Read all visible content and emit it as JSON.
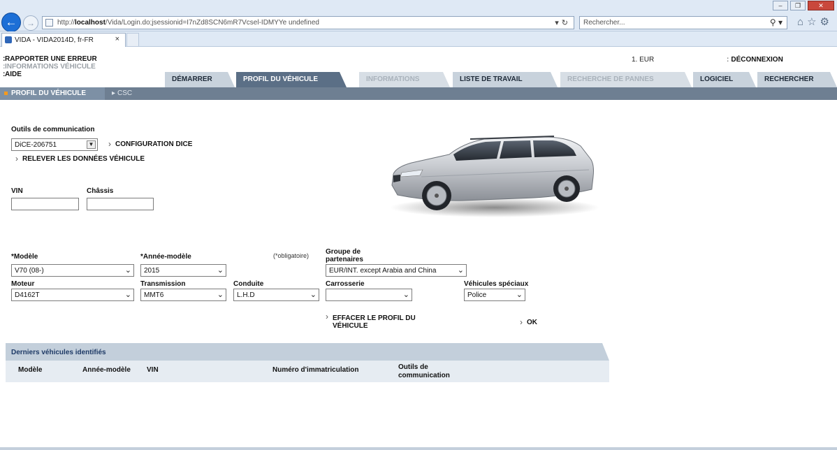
{
  "browser": {
    "url_prefix": "http://",
    "url_host": "localhost",
    "url_rest": "/Vida/Login.do;jsessionid=I7nZd8SCN6mR7Vcsel-IDMYYe undefined",
    "search_placeholder": "Rechercher...",
    "tab_title": "VIDA - VIDA2014D, fr-FR",
    "tab_close": "×"
  },
  "header": {
    "links": [
      "RAPPORTER UNE ERREUR",
      "INFORMATIONS VÉHICULE",
      "AIDE"
    ],
    "currency": "1. EUR",
    "logout": "DÉCONNEXION"
  },
  "tabs": [
    {
      "label": "DÉMARRER",
      "state": "normal"
    },
    {
      "label": "PROFIL DU VÉHICULE",
      "state": "active"
    },
    {
      "label": "INFORMATIONS",
      "state": "disabled"
    },
    {
      "label": "LISTE DE TRAVAIL",
      "state": "normal"
    },
    {
      "label": "RECHERCHE DE PANNES",
      "state": "disabled"
    },
    {
      "label": "LOGICIEL",
      "state": "normal"
    },
    {
      "label": "RECHERCHER",
      "state": "normal"
    }
  ],
  "breadcrumb": {
    "active": "PROFIL DU VÉHICULE",
    "next": "CSC"
  },
  "comm": {
    "label": "Outils de communication",
    "device": "DiCE-206751",
    "config_link": "CONFIGURATION DICE",
    "read_link": "RELEVER LES DONNÉES VÉHICULE"
  },
  "ident": {
    "vin_label": "VIN",
    "chassis_label": "Châssis",
    "vin_value": "",
    "chassis_value": ""
  },
  "form": {
    "required_note": "(*obligatoire)",
    "model_label": "*Modèle",
    "model_value": "V70 (08-)",
    "year_label": "*Année-modèle",
    "year_value": "2015",
    "partner_label_1": "Groupe de",
    "partner_label_2": "partenaires",
    "partner_value": "EUR/INT. except Arabia and China",
    "engine_label": "Moteur",
    "engine_value": "D4162T",
    "transmission_label": "Transmission",
    "transmission_value": "MMT6",
    "drive_label": "Conduite",
    "drive_value": "L.H.D",
    "body_label": "Carrosserie",
    "body_value": "",
    "special_label": "Véhicules spéciaux",
    "special_value": "Police",
    "clear_link_1": "EFFACER LE PROFIL DU",
    "clear_link_2": "VÉHICULE",
    "ok_link": "OK"
  },
  "recent": {
    "title": "Derniers véhicules identifiés",
    "columns": [
      "Modèle",
      "Année-modèle",
      "VIN",
      "Numéro d'immatriculation",
      "Outils de",
      "communication"
    ]
  },
  "colors": {
    "active_tab": "#5b6f86",
    "tab": "#c8d2dc",
    "accent": "#f59a1e",
    "recent_header": "#c3cfdb"
  }
}
